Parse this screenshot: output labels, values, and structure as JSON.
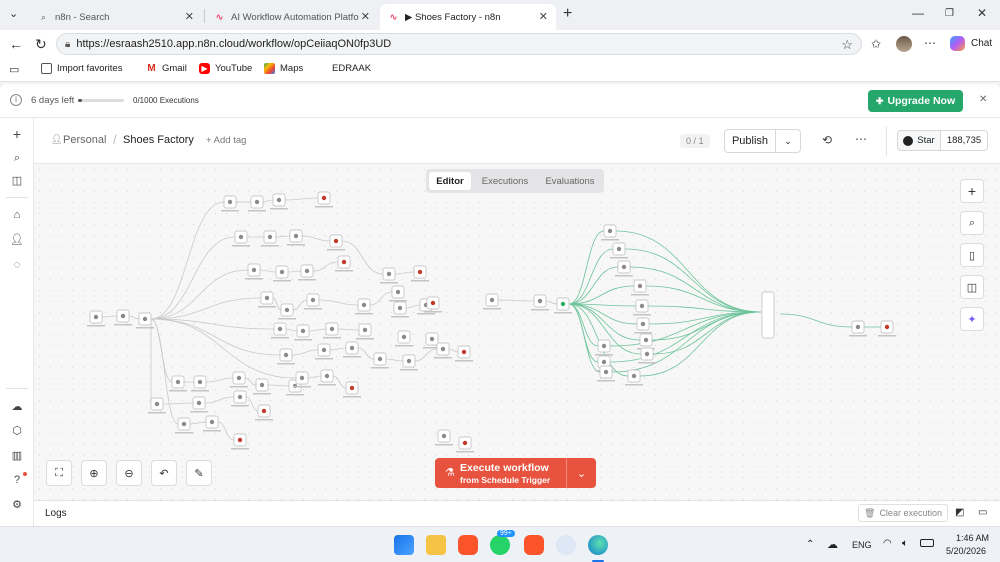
{
  "browser": {
    "tabs": [
      {
        "title": "n8n - Search",
        "favicon": "search-icon"
      },
      {
        "title": "AI Workflow Automation Platform",
        "favicon": "n8n-logo-icon"
      },
      {
        "title": "▶ Shoes Factory - n8n",
        "favicon": "n8n-logo-icon"
      }
    ],
    "url": "https://esraash2510.app.n8n.cloud/workflow/opCeiiaqON0fp3UD",
    "chat_label": "Chat",
    "bookmarks": [
      "Import favorites",
      "Gmail",
      "YouTube",
      "Maps",
      "EDRAAK"
    ]
  },
  "trial": {
    "days_left": "6 days left",
    "executions": "0/1000 Executions",
    "executions_used_fraction": 0,
    "upgrade_label": "Upgrade Now"
  },
  "header": {
    "breadcrumb_owner": "Personal",
    "workflow_name": "Shoes Factory",
    "add_tag": "+ Add tag",
    "version_counter": "0 / 1",
    "publish_label": "Publish",
    "star_label": "Star",
    "star_count": "188,735"
  },
  "view_tabs": [
    "Editor",
    "Executions",
    "Evaluations"
  ],
  "active_view": "Editor",
  "execute": {
    "label": "Execute workflow",
    "sublabel": "from Schedule Trigger"
  },
  "logs_label": "Logs",
  "clear_execution_label": "Clear execution",
  "taskbar": {
    "language": "ENG",
    "time": "1:46 AM",
    "date": "5/20/2026",
    "whatsapp_badge": "99+"
  }
}
